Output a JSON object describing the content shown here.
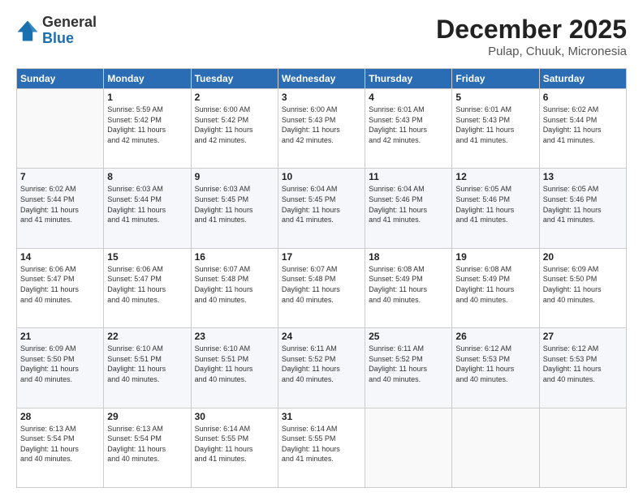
{
  "logo": {
    "general": "General",
    "blue": "Blue"
  },
  "header": {
    "title": "December 2025",
    "location": "Pulap, Chuuk, Micronesia"
  },
  "days_of_week": [
    "Sunday",
    "Monday",
    "Tuesday",
    "Wednesday",
    "Thursday",
    "Friday",
    "Saturday"
  ],
  "weeks": [
    [
      {
        "day": "",
        "info": ""
      },
      {
        "day": "1",
        "info": "Sunrise: 5:59 AM\nSunset: 5:42 PM\nDaylight: 11 hours\nand 42 minutes."
      },
      {
        "day": "2",
        "info": "Sunrise: 6:00 AM\nSunset: 5:42 PM\nDaylight: 11 hours\nand 42 minutes."
      },
      {
        "day": "3",
        "info": "Sunrise: 6:00 AM\nSunset: 5:43 PM\nDaylight: 11 hours\nand 42 minutes."
      },
      {
        "day": "4",
        "info": "Sunrise: 6:01 AM\nSunset: 5:43 PM\nDaylight: 11 hours\nand 42 minutes."
      },
      {
        "day": "5",
        "info": "Sunrise: 6:01 AM\nSunset: 5:43 PM\nDaylight: 11 hours\nand 41 minutes."
      },
      {
        "day": "6",
        "info": "Sunrise: 6:02 AM\nSunset: 5:44 PM\nDaylight: 11 hours\nand 41 minutes."
      }
    ],
    [
      {
        "day": "7",
        "info": "Sunrise: 6:02 AM\nSunset: 5:44 PM\nDaylight: 11 hours\nand 41 minutes."
      },
      {
        "day": "8",
        "info": "Sunrise: 6:03 AM\nSunset: 5:44 PM\nDaylight: 11 hours\nand 41 minutes."
      },
      {
        "day": "9",
        "info": "Sunrise: 6:03 AM\nSunset: 5:45 PM\nDaylight: 11 hours\nand 41 minutes."
      },
      {
        "day": "10",
        "info": "Sunrise: 6:04 AM\nSunset: 5:45 PM\nDaylight: 11 hours\nand 41 minutes."
      },
      {
        "day": "11",
        "info": "Sunrise: 6:04 AM\nSunset: 5:46 PM\nDaylight: 11 hours\nand 41 minutes."
      },
      {
        "day": "12",
        "info": "Sunrise: 6:05 AM\nSunset: 5:46 PM\nDaylight: 11 hours\nand 41 minutes."
      },
      {
        "day": "13",
        "info": "Sunrise: 6:05 AM\nSunset: 5:46 PM\nDaylight: 11 hours\nand 41 minutes."
      }
    ],
    [
      {
        "day": "14",
        "info": "Sunrise: 6:06 AM\nSunset: 5:47 PM\nDaylight: 11 hours\nand 40 minutes."
      },
      {
        "day": "15",
        "info": "Sunrise: 6:06 AM\nSunset: 5:47 PM\nDaylight: 11 hours\nand 40 minutes."
      },
      {
        "day": "16",
        "info": "Sunrise: 6:07 AM\nSunset: 5:48 PM\nDaylight: 11 hours\nand 40 minutes."
      },
      {
        "day": "17",
        "info": "Sunrise: 6:07 AM\nSunset: 5:48 PM\nDaylight: 11 hours\nand 40 minutes."
      },
      {
        "day": "18",
        "info": "Sunrise: 6:08 AM\nSunset: 5:49 PM\nDaylight: 11 hours\nand 40 minutes."
      },
      {
        "day": "19",
        "info": "Sunrise: 6:08 AM\nSunset: 5:49 PM\nDaylight: 11 hours\nand 40 minutes."
      },
      {
        "day": "20",
        "info": "Sunrise: 6:09 AM\nSunset: 5:50 PM\nDaylight: 11 hours\nand 40 minutes."
      }
    ],
    [
      {
        "day": "21",
        "info": "Sunrise: 6:09 AM\nSunset: 5:50 PM\nDaylight: 11 hours\nand 40 minutes."
      },
      {
        "day": "22",
        "info": "Sunrise: 6:10 AM\nSunset: 5:51 PM\nDaylight: 11 hours\nand 40 minutes."
      },
      {
        "day": "23",
        "info": "Sunrise: 6:10 AM\nSunset: 5:51 PM\nDaylight: 11 hours\nand 40 minutes."
      },
      {
        "day": "24",
        "info": "Sunrise: 6:11 AM\nSunset: 5:52 PM\nDaylight: 11 hours\nand 40 minutes."
      },
      {
        "day": "25",
        "info": "Sunrise: 6:11 AM\nSunset: 5:52 PM\nDaylight: 11 hours\nand 40 minutes."
      },
      {
        "day": "26",
        "info": "Sunrise: 6:12 AM\nSunset: 5:53 PM\nDaylight: 11 hours\nand 40 minutes."
      },
      {
        "day": "27",
        "info": "Sunrise: 6:12 AM\nSunset: 5:53 PM\nDaylight: 11 hours\nand 40 minutes."
      }
    ],
    [
      {
        "day": "28",
        "info": "Sunrise: 6:13 AM\nSunset: 5:54 PM\nDaylight: 11 hours\nand 40 minutes."
      },
      {
        "day": "29",
        "info": "Sunrise: 6:13 AM\nSunset: 5:54 PM\nDaylight: 11 hours\nand 40 minutes."
      },
      {
        "day": "30",
        "info": "Sunrise: 6:14 AM\nSunset: 5:55 PM\nDaylight: 11 hours\nand 41 minutes."
      },
      {
        "day": "31",
        "info": "Sunrise: 6:14 AM\nSunset: 5:55 PM\nDaylight: 11 hours\nand 41 minutes."
      },
      {
        "day": "",
        "info": ""
      },
      {
        "day": "",
        "info": ""
      },
      {
        "day": "",
        "info": ""
      }
    ]
  ]
}
